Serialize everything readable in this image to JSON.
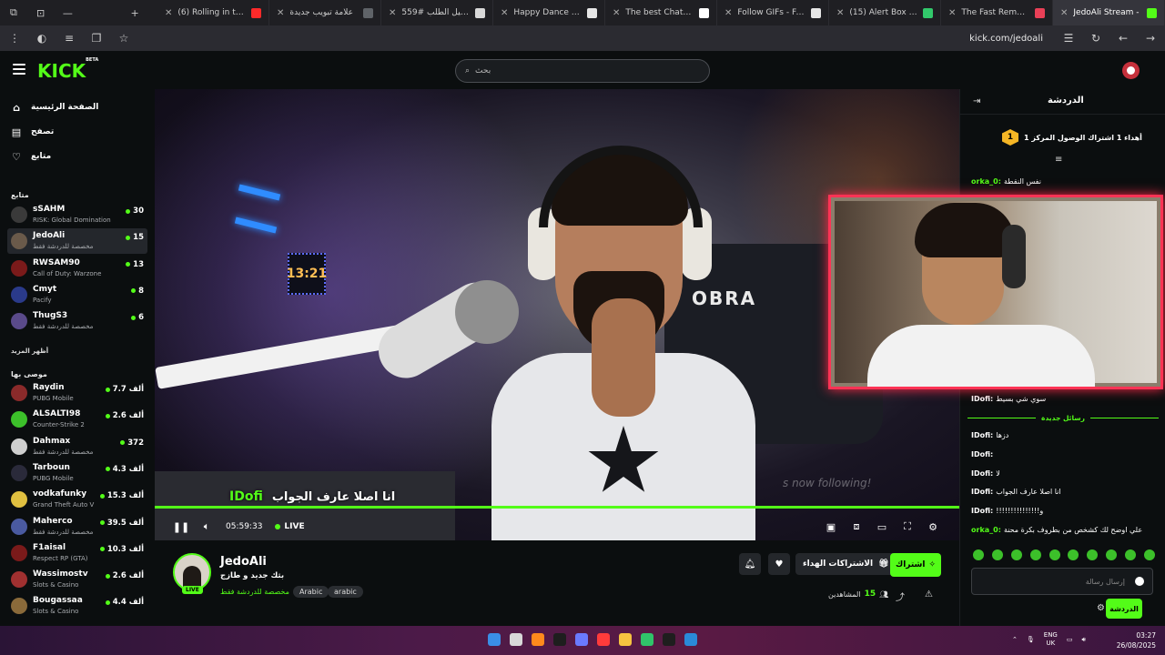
{
  "browser": {
    "tabs": [
      {
        "title": "(6) Rolling in the Dee",
        "favicon_color": "#ff2a2a"
      },
      {
        "title": "علامة تبويب جديدة",
        "favicon_color": "#5f6368"
      },
      {
        "title": "تفاصيل الطلب #559",
        "favicon_color": "#d8d8d8"
      },
      {
        "title": "Happy Dance GIF - Fi",
        "favicon_color": "#e6e6e6"
      },
      {
        "title": "The best ChatBot and",
        "favicon_color": "#ffffff"
      },
      {
        "title": "Follow GIFs - Find &",
        "favicon_color": "#e6e6e6"
      },
      {
        "title": "(15) Alert Box / Strea",
        "favicon_color": "#32c96b"
      },
      {
        "title": "The Fast Remote Des",
        "favicon_color": "#e94057"
      },
      {
        "title": "JedoAli Stream -",
        "favicon_color": "#53fc18"
      }
    ],
    "url": "kick.com/jedoali"
  },
  "kick": {
    "logo": "KICK",
    "logo_badge": "BETA",
    "search_placeholder": "بحث"
  },
  "sidebar": {
    "nav": [
      {
        "label": "الصفحة الرئيسية",
        "icon": "home-icon"
      },
      {
        "label": "تصفح",
        "icon": "browse-icon"
      },
      {
        "label": "متابع",
        "icon": "heart-icon"
      }
    ],
    "following_title": "متابع",
    "following": [
      {
        "name": "sSAHM",
        "category": "RISK: Global Domination",
        "count": "30",
        "color": "#3a3a3a"
      },
      {
        "name": "JedoAli",
        "category": "مخصصة للدردشة فقط",
        "count": "15",
        "color": "#6a5a4a"
      },
      {
        "name": "RWSAM90",
        "category": "Call of Duty: Warzone",
        "count": "13",
        "color": "#7a1a1a"
      },
      {
        "name": "Cmyt",
        "category": "Pacify",
        "count": "8",
        "color": "#2a3a8a"
      },
      {
        "name": "ThugS3",
        "category": "مخصصة للدردشة فقط",
        "count": "6",
        "color": "#5a4a8a"
      }
    ],
    "show_more": "أظهر المزيد",
    "recommended_title": "موصى بها",
    "recommended": [
      {
        "name": "Raydin",
        "category": "PUBG Mobile",
        "count": "7.7 ألف",
        "color": "#8a2a2a"
      },
      {
        "name": "ALSALTI98",
        "category": "Counter-Strike 2",
        "count": "2.6 ألف",
        "color": "#3cc02a"
      },
      {
        "name": "Dahmax",
        "category": "مخصصة للدردشة فقط",
        "count": "372",
        "color": "#cfcfcf"
      },
      {
        "name": "Tarboun",
        "category": "PUBG Mobile",
        "count": "4.3 ألف",
        "color": "#2a2a3a"
      },
      {
        "name": "vodkafunky",
        "category": "Grand Theft Auto V",
        "count": "15.3 ألف",
        "color": "#e0c040"
      },
      {
        "name": "Maherco",
        "category": "مخصصة للدردشة فقط",
        "count": "39.5 ألف",
        "color": "#4a5aa0"
      },
      {
        "name": "F1aisal",
        "category": "Respect RP (GTA)",
        "count": "10.3 ألف",
        "color": "#7a1a1a"
      },
      {
        "name": "Wassimostv",
        "category": "Slots & Casino",
        "count": "2.6 ألف",
        "color": "#a03030"
      },
      {
        "name": "Bougassaa",
        "category": "Slots & Casino",
        "count": "4.4 ألف",
        "color": "#8a6a3a"
      }
    ]
  },
  "video": {
    "caption_name": "IDofi",
    "caption_text": "انا اصلا عارف الجواب",
    "follow_ghost": "s now following!",
    "chair_text": "OBRA",
    "clock_text": "13:21",
    "elapsed": "05:59:33",
    "live_label": "LIVE"
  },
  "stream": {
    "streamer": "JedoAli",
    "live_badge": "LIVE",
    "title": "بثك جديد و طازج",
    "category": "مخصصة للدردشة فقط",
    "tags": [
      "Arabic",
      "arabic"
    ],
    "gift_label": "الاشتراكات الهداء",
    "subscribe_label": "اشتراك",
    "viewers_label": "المشاهدين",
    "viewers_count": "15"
  },
  "chat": {
    "title": "الدردشة",
    "goal_number": "1",
    "goal_text": "أهداء 1 اشتراك الوصول المركز 1",
    "messages_top": [
      {
        "user": "orka_0:",
        "text": "نفس النقطة",
        "color": "#53fc18"
      }
    ],
    "pinned_after_pip": {
      "user": "IDofi:",
      "text": "سوي شي بسيط",
      "color": "#ffffff"
    },
    "new_messages_label": "رسائل جديدة",
    "messages": [
      {
        "user": "IDofi:",
        "text": "دزها",
        "color": "#ffffff"
      },
      {
        "user": "IDofi:",
        "text": "",
        "color": "#ffffff"
      },
      {
        "user": "IDofi:",
        "text": "لا",
        "color": "#ffffff"
      },
      {
        "user": "IDofi:",
        "text": "انا اصلا عارف الجواب",
        "color": "#ffffff"
      },
      {
        "user": "IDofi:",
        "text": "!!!!!!!!!!!!!!!و",
        "color": "#ffffff"
      },
      {
        "user": "orka_0:",
        "text": "علي اوضح لك كشخص من بطروف بكرة محنة",
        "color": "#53fc18"
      }
    ],
    "input_placeholder": "إرسال رسالة",
    "send_label": "الدردشة"
  },
  "taskbar": {
    "lang_top": "ENG",
    "lang_bottom": "UK",
    "time": "03:27",
    "date": "26/08/2025"
  }
}
